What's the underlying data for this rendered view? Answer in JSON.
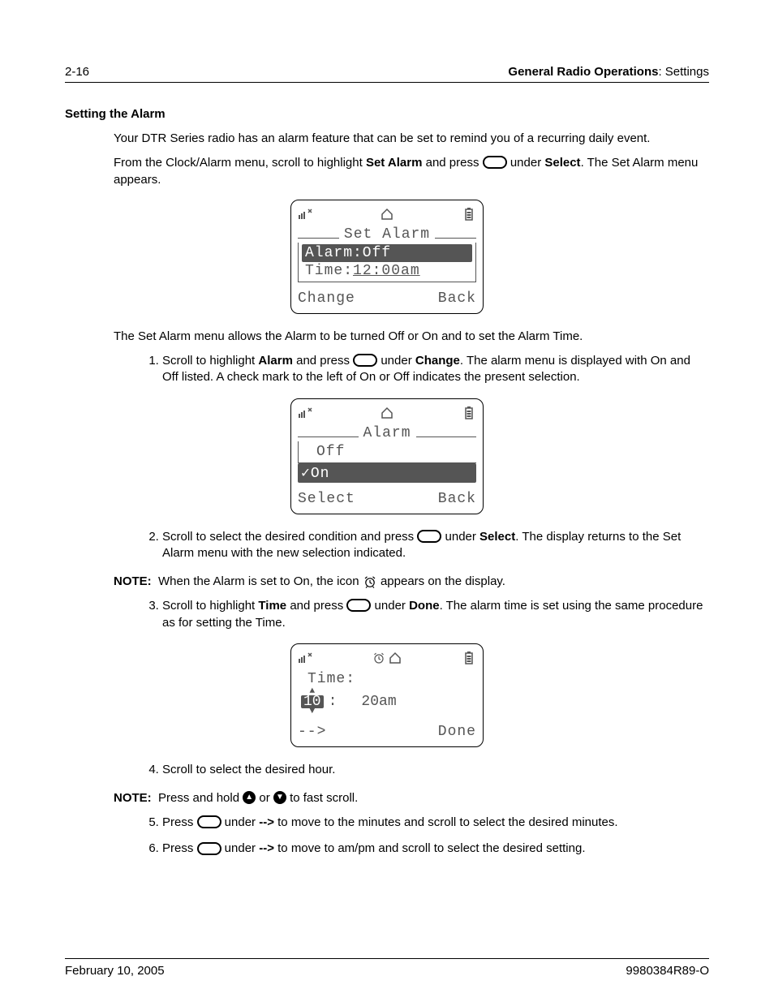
{
  "header": {
    "page_num": "2-16",
    "section_bold": "General Radio Operations",
    "section_tail": ": Settings"
  },
  "section_title": "Setting the Alarm",
  "intro_para": "Your DTR Series radio has an alarm feature that can be set to remind you of a recurring daily event.",
  "intro_para2_a": "From the Clock/Alarm menu, scroll to highlight ",
  "intro_para2_b": "Set Alarm",
  "intro_para2_c": " and press ",
  "intro_para2_d": " under ",
  "intro_para2_e": "Select",
  "intro_para2_f": ". The Set Alarm menu appears.",
  "lcd1": {
    "title": "Set Alarm",
    "row1": "Alarm:Off",
    "row2_pre": "Time:",
    "row2_val": "12:00am",
    "left": "Change",
    "right": "Back"
  },
  "after_lcd1": "The Set Alarm menu allows the Alarm to be turned Off or On and to set the Alarm Time.",
  "step1_a": "Scroll to highlight ",
  "step1_b": "Alarm",
  "step1_c": " and press ",
  "step1_d": " under ",
  "step1_e": "Change",
  "step1_f": ". The alarm menu is displayed with On and Off listed. A check mark to the left of On or Off indicates the present selection.",
  "lcd2": {
    "title": "Alarm",
    "row1": "Off",
    "row2": "✓On",
    "left": "Select",
    "right": "Back"
  },
  "step2_a": "Scroll to select the desired condition and press ",
  "step2_b": " under ",
  "step2_c": "Select",
  "step2_d": ". The display returns to the Set Alarm menu with the new selection indicated.",
  "note1_label": "NOTE:",
  "note1_a": "When the Alarm is set to On, the icon ",
  "note1_b": " appears on the display.",
  "step3_a": "Scroll to highlight ",
  "step3_b": "Time",
  "step3_c": " and press ",
  "step3_d": " under ",
  "step3_e": "Done",
  "step3_f": ". The alarm time is set using the same procedure as for setting the Time.",
  "lcd3": {
    "label": "Time:",
    "hour": "10",
    "colon": ":",
    "rest": "20am",
    "left": "-->",
    "right": "Done"
  },
  "step4": "Scroll to select the desired hour.",
  "note2_label": "NOTE:",
  "note2_a": "Press and hold ",
  "note2_b": " or ",
  "note2_c": " to fast scroll.",
  "step5_a": "Press ",
  "step5_b": " under ",
  "step5_c": "-->",
  "step5_d": " to move to the minutes and scroll to select the desired minutes.",
  "step6_a": "Press ",
  "step6_b": " under ",
  "step6_c": "-->",
  "step6_d": " to move to am/pm and scroll to select the desired setting.",
  "footer": {
    "date": "February 10, 2005",
    "doc": "9980384R89-O"
  }
}
